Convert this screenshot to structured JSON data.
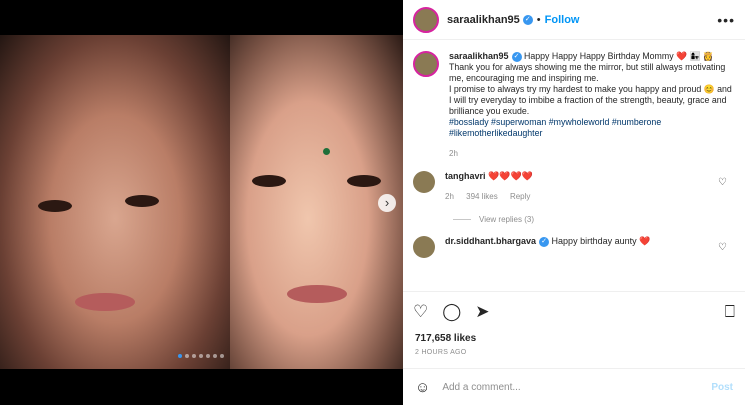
{
  "post": {
    "username": "saraalikhan95",
    "follow_label": "Follow",
    "more_label": "•••",
    "caption_first": "Happy Happy Happy Birthday Mommy",
    "caption_emoji": "❤️ 👩‍👧 👸",
    "caption_line1": "Thank you for always showing me the mirror, but still always motivating me, encouraging me and inspiring me.",
    "caption_line2": "I promise to always try my hardest to make you happy and proud 😊 and I will try everyday to imbibe a fraction of the strength, beauty, grace and brilliance you exude.",
    "hashtags": "#bosslady #superwoman #mywholeworld #numberone #likemotherlikedaughter",
    "caption_age": "2h",
    "likes": "717,658 likes",
    "time": "2 HOURS AGO",
    "add_comment_placeholder": "Add a comment...",
    "post_label": "Post"
  },
  "comments": [
    {
      "user": "tanghavri",
      "text": "❤️❤️❤️❤️",
      "age": "2h",
      "likes": "394 likes",
      "reply": "Reply"
    },
    {
      "user": "dr.siddhant.bhargava",
      "text": "Happy birthday aunty ❤️"
    }
  ],
  "view_replies": "View replies (3)",
  "carousel": {
    "total": 7,
    "active": 0
  },
  "colors": {
    "accent": "#0095f6",
    "verified": "#3897f0",
    "heart": "#ed4956"
  }
}
